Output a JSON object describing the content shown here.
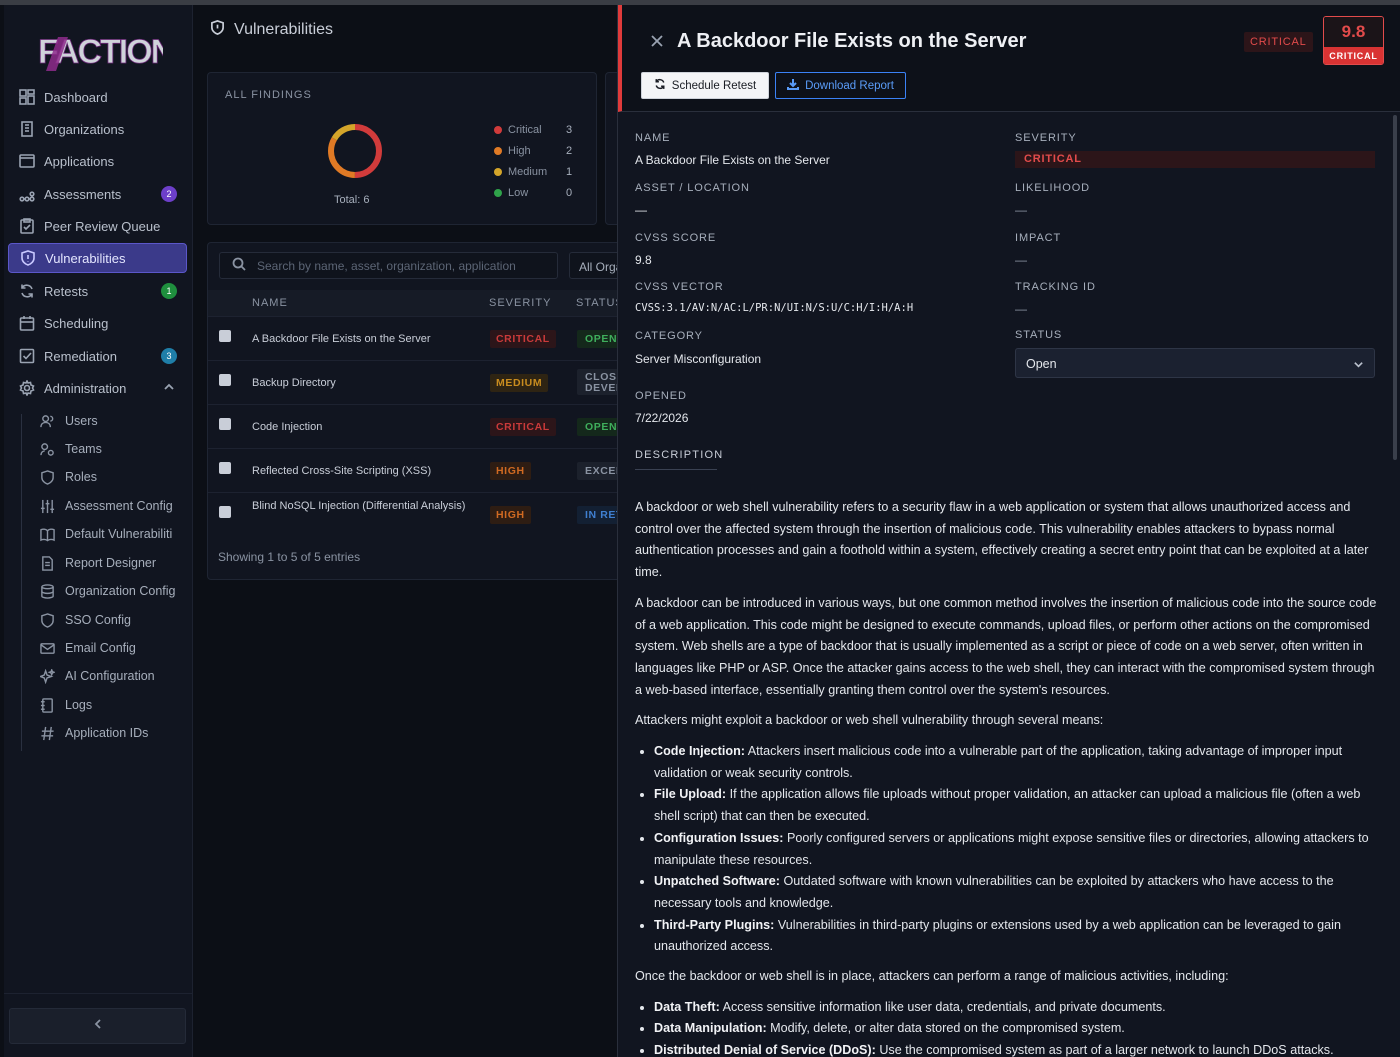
{
  "app": {
    "logo_text": "FACTION"
  },
  "sidebar": {
    "items": [
      {
        "label": "Dashboard",
        "icon": "dashboard-icon"
      },
      {
        "label": "Organizations",
        "icon": "building-icon"
      },
      {
        "label": "Applications",
        "icon": "window-icon"
      },
      {
        "label": "Assessments",
        "icon": "nodes-icon",
        "badge": "2"
      },
      {
        "label": "Peer Review Queue",
        "icon": "clipboard-icon"
      },
      {
        "label": "Vulnerabilities",
        "icon": "shield-icon",
        "active": true
      },
      {
        "label": "Retests",
        "icon": "refresh-icon",
        "badge": "1"
      },
      {
        "label": "Scheduling",
        "icon": "calendar-icon"
      },
      {
        "label": "Remediation",
        "icon": "check-square-icon",
        "badge": "3"
      },
      {
        "label": "Administration",
        "icon": "gear-icon",
        "expanded": true
      }
    ],
    "admin_items": [
      {
        "label": "Users",
        "icon": "users-icon"
      },
      {
        "label": "Teams",
        "icon": "team-icon"
      },
      {
        "label": "Roles",
        "icon": "shield-icon"
      },
      {
        "label": "Assessment Config",
        "icon": "sliders-icon"
      },
      {
        "label": "Default Vulnerabiliti",
        "icon": "book-icon"
      },
      {
        "label": "Report Designer",
        "icon": "document-icon"
      },
      {
        "label": "Organization Config",
        "icon": "database-icon"
      },
      {
        "label": "SSO Config",
        "icon": "shield-icon"
      },
      {
        "label": "Email Config",
        "icon": "mail-icon"
      },
      {
        "label": "AI Configuration",
        "icon": "sparkle-icon"
      },
      {
        "label": "Logs",
        "icon": "log-icon"
      },
      {
        "label": "Application IDs",
        "icon": "hash-icon"
      }
    ]
  },
  "main": {
    "title": "Vulnerabilities",
    "findings": {
      "label": "ALL FINDINGS",
      "total_label": "Total: 6",
      "legend": [
        {
          "label": "Critical",
          "count": "3",
          "color": "#d13b3b"
        },
        {
          "label": "High",
          "count": "2",
          "color": "#e07a25"
        },
        {
          "label": "Medium",
          "count": "1",
          "color": "#d4a52a"
        },
        {
          "label": "Low",
          "count": "0",
          "color": "#2fa34a"
        }
      ]
    },
    "search": {
      "placeholder": "Search by name, asset, organization, application"
    },
    "filter_label": "All Organizations",
    "table": {
      "headers": {
        "name": "NAME",
        "severity": "SEVERITY",
        "status": "STATUS"
      },
      "rows": [
        {
          "name": "A Backdoor File Exists on the Server",
          "severity": "CRITICAL",
          "status": "OPEN"
        },
        {
          "name": "Backup Directory",
          "severity": "MEDIUM",
          "status": "CLOSED DEVEL"
        },
        {
          "name": "Code Injection",
          "severity": "CRITICAL",
          "status": "OPEN"
        },
        {
          "name": "Reflected Cross-Site Scripting (XSS)",
          "severity": "HIGH",
          "status": "EXCEPTION"
        },
        {
          "name": "Blind NoSQL Injection (Differential Analysis)",
          "severity": "HIGH",
          "status": "IN RETEST"
        }
      ],
      "showing": "Showing 1 to 5 of 5 entries"
    }
  },
  "detail": {
    "title": "A Backdoor File Exists on the Server",
    "severity_pill": "CRITICAL",
    "score": "9.8",
    "score_label": "CRITICAL",
    "buttons": {
      "retest": "Schedule Retest",
      "download": "Download Report"
    },
    "fields": {
      "name_label": "NAME",
      "name": "A Backdoor File Exists on the Server",
      "severity_label": "SEVERITY",
      "severity": "CRITICAL",
      "asset_label": "ASSET / LOCATION",
      "asset": "—",
      "likelihood_label": "LIKELIHOOD",
      "likelihood": "—",
      "cvss_label": "CVSS SCORE",
      "cvss": "9.8",
      "impact_label": "IMPACT",
      "impact": "—",
      "vector_label": "CVSS VECTOR",
      "vector": "CVSS:3.1/AV:N/AC:L/PR:N/UI:N/S:U/C:H/I:H/A:H",
      "tracking_label": "TRACKING ID",
      "tracking": "—",
      "category_label": "CATEGORY",
      "category": "Server Misconfiguration",
      "status_label": "STATUS",
      "status": "Open",
      "opened_label": "OPENED",
      "opened": "7/22/2026"
    },
    "description_tab": "DESCRIPTION",
    "description": {
      "p1": "A backdoor or web shell vulnerability refers to a security flaw in a web application or system that allows unauthorized access and control over the affected system through the insertion of malicious code. This vulnerability enables attackers to bypass normal authentication processes and gain a foothold within a system, effectively creating a secret entry point that can be exploited at a later time.",
      "p2": "A backdoor can be introduced in various ways, but one common method involves the insertion of malicious code into the source code of a web application. This code might be designed to execute commands, upload files, or perform other actions on the compromised system. Web shells are a type of backdoor that is usually implemented as a script or piece of code on a web server, often written in languages like PHP or ASP. Once the attacker gains access to the web shell, they can interact with the compromised system through a web-based interface, essentially granting them control over the system's resources.",
      "p3": "Attackers might exploit a backdoor or web shell vulnerability through several means:",
      "means": [
        {
          "term": "Code Injection:",
          "text": " Attackers insert malicious code into a vulnerable part of the application, taking advantage of improper input validation or weak security controls."
        },
        {
          "term": "File Upload:",
          "text": " If the application allows file uploads without proper validation, an attacker can upload a malicious file (often a web shell script) that can then be executed."
        },
        {
          "term": "Configuration Issues:",
          "text": " Poorly configured servers or applications might expose sensitive files or directories, allowing attackers to manipulate these resources."
        },
        {
          "term": "Unpatched Software:",
          "text": " Outdated software with known vulnerabilities can be exploited by attackers who have access to the necessary tools and knowledge."
        },
        {
          "term": "Third-Party Plugins:",
          "text": " Vulnerabilities in third-party plugins or extensions used by a web application can be leveraged to gain unauthorized access."
        }
      ],
      "p4": "Once the backdoor or web shell is in place, attackers can perform a range of malicious activities, including:",
      "activities": [
        {
          "term": "Data Theft:",
          "text": " Access sensitive information like user data, credentials, and private documents."
        },
        {
          "term": "Data Manipulation:",
          "text": " Modify, delete, or alter data stored on the compromised system."
        },
        {
          "term": "Distributed Denial of Service (DDoS):",
          "text": " Use the compromised system as part of a larger network to launch DDoS attacks."
        }
      ]
    }
  }
}
